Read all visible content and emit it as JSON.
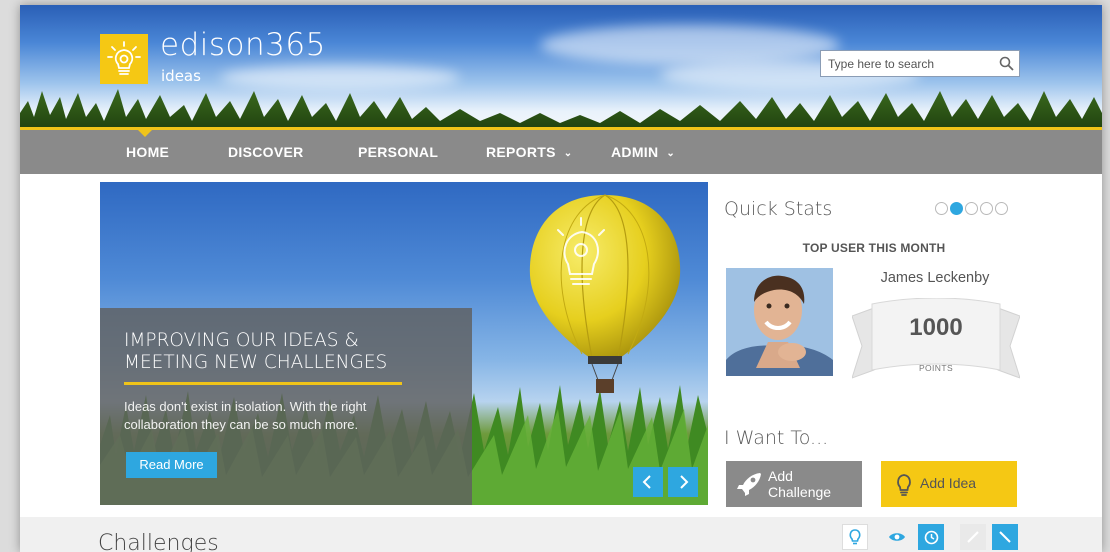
{
  "brand": {
    "name": "edison365",
    "sub": "ideas",
    "accent": "#f5c814"
  },
  "search": {
    "placeholder": "Type here to search",
    "icon": "search-icon"
  },
  "nav": {
    "items": [
      {
        "label": "HOME",
        "active": true
      },
      {
        "label": "DISCOVER"
      },
      {
        "label": "PERSONAL"
      },
      {
        "label": "REPORTS",
        "caret": "⌄"
      },
      {
        "label": "ADMIN",
        "caret": "⌄"
      }
    ],
    "background": "#8a8a8a"
  },
  "hero": {
    "title_line1": "IMPROVING OUR IDEAS &",
    "title_line2": "MEETING NEW CHALLENGES",
    "desc_line1": "Ideas don't exist in isolation. With the right",
    "desc_line2": "collaboration they can be so much more.",
    "button": "Read More",
    "prev_icon": "chevron-left-icon",
    "next_icon": "chevron-right-icon"
  },
  "quick_stats": {
    "heading": "Quick Stats",
    "carousel_dots": 5,
    "active_dot": 2,
    "top_user_label": "TOP USER THIS MONTH",
    "user_name": "James Leckenby",
    "points": "1000",
    "points_label": "POINTS"
  },
  "i_want_to": {
    "heading": "I Want To...",
    "challenge_line1": "Add",
    "challenge_line2": "Challenge",
    "challenge_icon": "rocket-icon",
    "idea_label": "Add Idea",
    "idea_icon": "lightbulb-icon"
  },
  "challenges": {
    "title": "Challenges",
    "filters": [
      "lightbulb-icon",
      "eye-icon",
      "clock-icon",
      "pencil-icon",
      "arrow-icon"
    ]
  },
  "colors": {
    "blue": "#2ea7e0",
    "grey": "#8a8a8a",
    "yellow": "#f5c814"
  }
}
